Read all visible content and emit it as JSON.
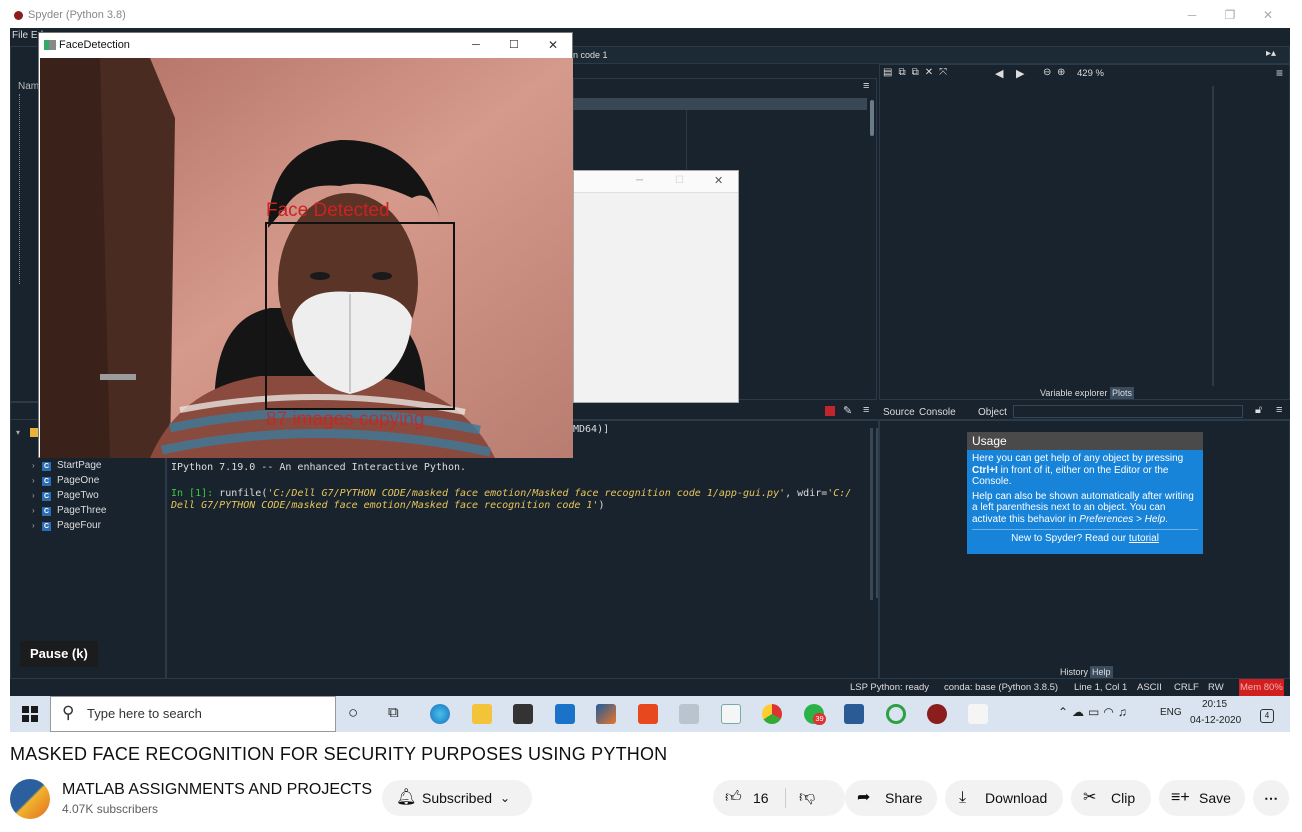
{
  "spyder": {
    "window_title": "Spyder (Python 3.8)",
    "menu_label": "File Ed",
    "editor_tab_label": "n code 1",
    "tree_header": "Nam",
    "zoom_level": "429 %",
    "tree_items": [
      "StartPage",
      "PageOne",
      "PageTwo",
      "PageThree",
      "PageFour"
    ],
    "console_fragment": "MD64)]",
    "console_lines": {
      "ipython_banner": "IPython 7.19.0 -- An enhanced Interactive Python.",
      "prompt": "In [1]:",
      "cmd_func": " runfile(",
      "cmd_arg1": "'C:/Dell G7/PYTHON CODE/masked face emotion/Masked face recognition code 1/app-gui.py'",
      "cmd_mid": ", wdir=",
      "cmd_arg2_a": "'C:/",
      "cmd_arg2_b": "Dell G7/PYTHON CODE/masked face emotion/Masked face recognition code 1'",
      "cmd_end": ")"
    },
    "plots_tabs": {
      "variable_explorer": "Variable explorer",
      "plots": "Plots"
    },
    "help_tabs": {
      "source": "Source",
      "console": "Console",
      "object": "Object"
    },
    "bottom_tabs": {
      "history": "History",
      "help": "Help"
    },
    "usage": {
      "heading": "Usage",
      "p1_pre": "Here you can get help of any object by pressing ",
      "p1_key": "Ctrl+I",
      "p1_post": " in front of it, either on the Editor or the Console.",
      "p2_pre": "Help can also be shown automatically after writing a left parenthesis next to an object. You can activate this behavior in ",
      "p2_em": "Preferences > Help",
      "p2_post": ".",
      "footer_pre": "New to Spyder? Read our ",
      "footer_link": "tutorial"
    },
    "status": {
      "lsp": "LSP Python: ready",
      "conda": "conda: base (Python 3.8.5)",
      "position": "Line 1, Col 1",
      "encoding": "ASCII",
      "eol": "CRLF",
      "mode": "RW",
      "mem": "Mem 80%"
    }
  },
  "face_window": {
    "title": "FaceDetection",
    "overlay_top": "Face Detected",
    "overlay_bottom": "87 images copying"
  },
  "pause_tooltip": "Pause (k)",
  "taskbar": {
    "search_placeholder": "Type here to search",
    "lang": "ENG",
    "time": "20:15",
    "date": "04-12-2020",
    "notif_count": "4",
    "whatsapp_badge": "39"
  },
  "youtube": {
    "video_title": "MASKED FACE RECOGNITION FOR SECURITY PURPOSES USING PYTHON",
    "channel_name": "MATLAB ASSIGNMENTS AND PROJECTS",
    "subscribers": "4.07K subscribers",
    "subscribe_label": "Subscribed",
    "like_count": "16",
    "share_label": "Share",
    "download_label": "Download",
    "clip_label": "Clip",
    "save_label": "Save"
  }
}
